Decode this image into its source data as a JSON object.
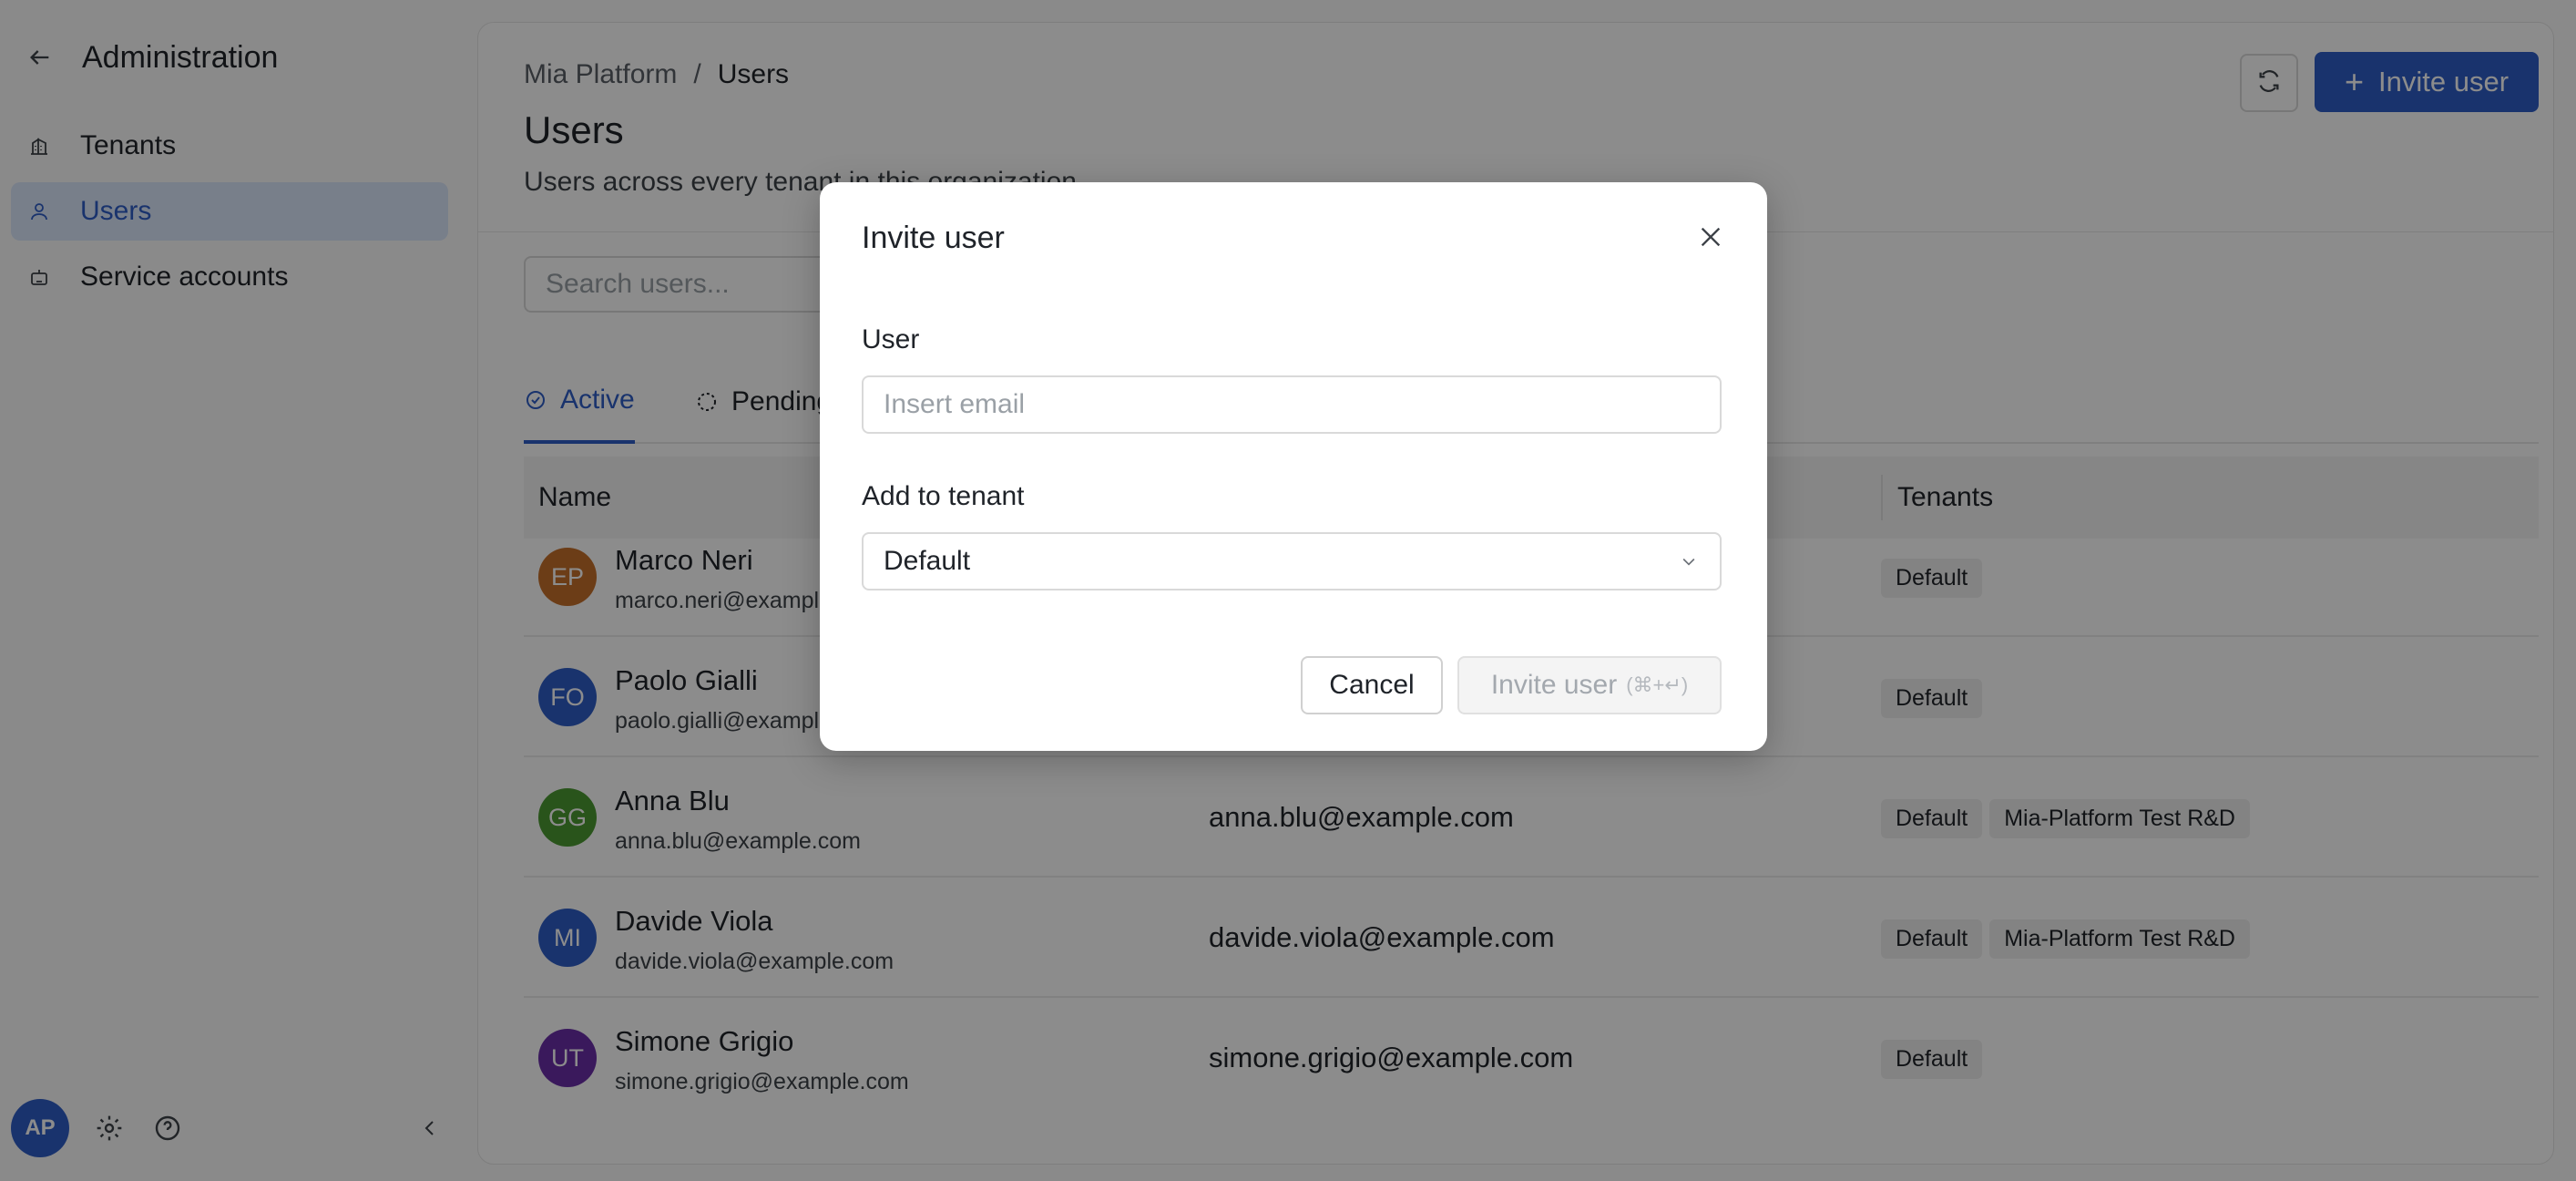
{
  "sidebar": {
    "title": "Administration",
    "back_icon": "arrow-left-icon",
    "items": [
      {
        "label": "Tenants",
        "icon": "building-icon",
        "active": false
      },
      {
        "label": "Users",
        "icon": "user-icon",
        "active": true
      },
      {
        "label": "Service accounts",
        "icon": "robot-icon",
        "active": false
      }
    ],
    "footer": {
      "avatar_initials": "AP",
      "settings_icon": "gear-icon",
      "help_icon": "help-icon",
      "collapse_icon": "chevron-left-icon"
    }
  },
  "header": {
    "breadcrumb": [
      "Mia Platform",
      "Users"
    ],
    "title": "Users",
    "subtitle": "Users across every tenant in this organization",
    "refresh_icon": "refresh-icon",
    "invite_button": "Invite user"
  },
  "search": {
    "placeholder": "Search users..."
  },
  "tabs": [
    {
      "label": "Active",
      "icon": "check-circle-icon",
      "active": true
    },
    {
      "label": "Pending",
      "icon": "dashed-circle-icon",
      "active": false
    }
  ],
  "table": {
    "columns": {
      "name": "Name",
      "tenants": "Tenants"
    },
    "rows": [
      {
        "initials": "EP",
        "color": "#c56f2b",
        "name": "Marco Neri",
        "email": "marco.neri@example.com",
        "tenants": [
          "Default"
        ]
      },
      {
        "initials": "FO",
        "color": "#2f5dc6",
        "name": "Paolo Gialli",
        "email": "paolo.gialli@example.com",
        "tenants": [
          "Default"
        ]
      },
      {
        "initials": "GG",
        "color": "#4c9a32",
        "name": "Anna Blu",
        "email": "anna.blu@example.com",
        "tenants": [
          "Default",
          "Mia-Platform Test R&D"
        ]
      },
      {
        "initials": "MI",
        "color": "#2f5dc6",
        "name": "Davide Viola",
        "email": "davide.viola@example.com",
        "tenants": [
          "Default",
          "Mia-Platform Test R&D"
        ]
      },
      {
        "initials": "UT",
        "color": "#6a2fa8",
        "name": "Simone Grigio",
        "email": "simone.grigio@example.com",
        "tenants": [
          "Default"
        ]
      }
    ]
  },
  "modal": {
    "title": "Invite user",
    "close_icon": "close-icon",
    "user_label": "User",
    "email_placeholder": "Insert email",
    "tenant_label": "Add to tenant",
    "tenant_value": "Default",
    "cancel": "Cancel",
    "submit": "Invite user",
    "submit_shortcut": "(⌘+↵)"
  },
  "colors": {
    "accent": "#2f5dc6",
    "active_bg": "#dbe7fb"
  }
}
